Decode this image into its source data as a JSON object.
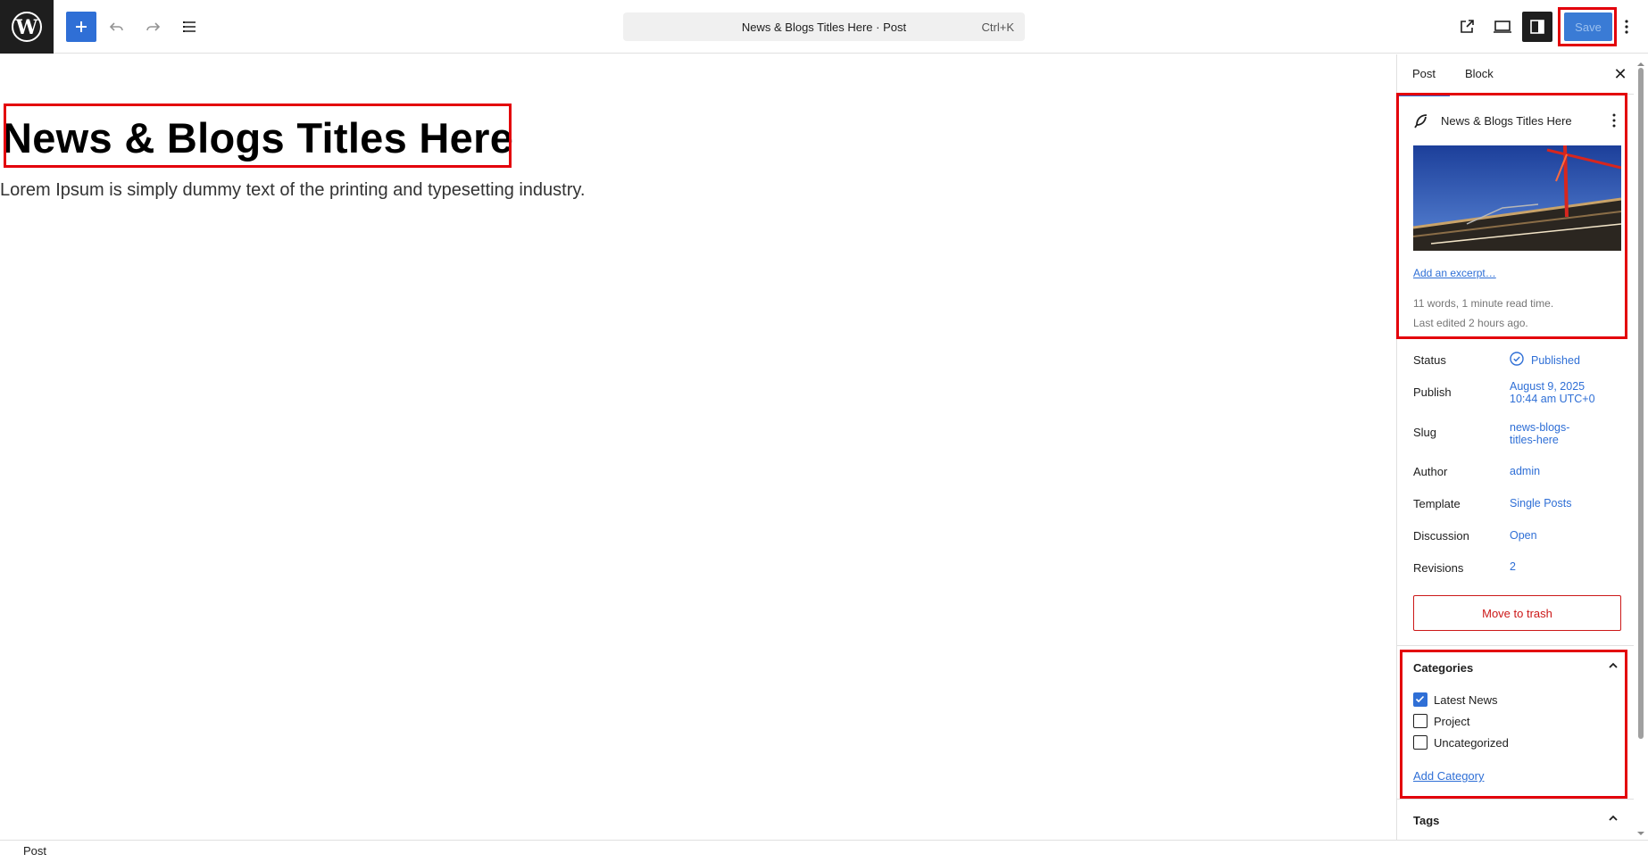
{
  "header": {
    "command_title": "News & Blogs Titles Here · Post",
    "command_shortcut": "Ctrl+K",
    "save_label": "Save"
  },
  "editor": {
    "title": "News & Blogs Titles Here",
    "paragraph": "Lorem Ipsum is simply dummy text of the printing and typesetting industry."
  },
  "sidebar": {
    "tabs": [
      "Post",
      "Block"
    ],
    "post_card": {
      "title": "News & Blogs Titles Here",
      "excerpt_link": "Add an excerpt…",
      "stats": "11 words, 1 minute read time.",
      "last_edited": "Last edited 2 hours ago."
    },
    "meta": [
      {
        "label": "Status",
        "value": "Published"
      },
      {
        "label": "Publish",
        "value": "August 9, 2025",
        "value2": "10:44 am UTC+0"
      },
      {
        "label": "Slug",
        "value": "news-blogs-",
        "value2": "titles-here"
      },
      {
        "label": "Author",
        "value": "admin"
      },
      {
        "label": "Template",
        "value": "Single Posts"
      },
      {
        "label": "Discussion",
        "value": "Open"
      },
      {
        "label": "Revisions",
        "value": "2"
      }
    ],
    "trash_label": "Move to trash",
    "categories": {
      "heading": "Categories",
      "items": [
        {
          "label": "Latest News",
          "checked": true
        },
        {
          "label": "Project",
          "checked": false
        },
        {
          "label": "Uncategorized",
          "checked": false
        }
      ],
      "add_link": "Add Category"
    },
    "tags_heading": "Tags"
  },
  "statusbar": {
    "breadcrumb": "Post"
  },
  "colors": {
    "accent": "#2f6fd6",
    "highlight": "#e3000b",
    "danger": "#cc1818"
  }
}
